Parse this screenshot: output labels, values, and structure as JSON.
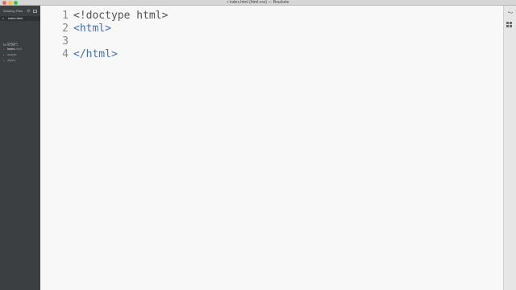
{
  "window": {
    "title": "• index.html (html-css) — Brackets"
  },
  "sidebar": {
    "working_files_label": "Working Files",
    "settings_icon": "gear-icon",
    "split_icon": "split-view-icon",
    "open_files": [
      {
        "close_glyph": "×",
        "name": "index.html"
      }
    ],
    "project": {
      "name": "html-css",
      "caret": "⌄"
    },
    "tree": [
      {
        "type": "folder",
        "caret": "▸",
        "name": "images",
        "ext": ""
      },
      {
        "type": "file",
        "bullet": "•",
        "name": "index",
        "ext": ".html"
      },
      {
        "type": "folder",
        "caret": "▸",
        "name": "scripts",
        "ext": ""
      },
      {
        "type": "folder",
        "caret": "▸",
        "name": "styles",
        "ext": ""
      }
    ]
  },
  "editor": {
    "lines": [
      {
        "number": "1",
        "text": "<!doctype html>",
        "kind": "doctype"
      },
      {
        "number": "2",
        "text": "<html>",
        "kind": "tag"
      },
      {
        "number": "3",
        "text": "",
        "kind": "plain"
      },
      {
        "number": "4",
        "text": "</html>",
        "kind": "tag"
      }
    ]
  },
  "toolbar": {
    "live_preview_icon": "live-preview-icon",
    "live_preview_glyph": "〜",
    "extension_manager_icon": "extension-manager-icon"
  }
}
